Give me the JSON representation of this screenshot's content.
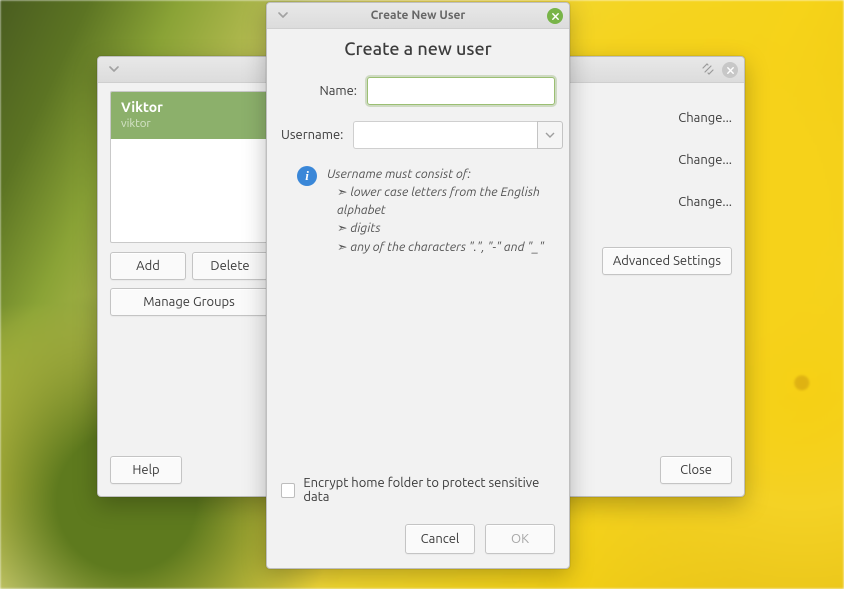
{
  "users_window": {
    "user": {
      "name": "Viktor",
      "role": "viktor"
    },
    "buttons": {
      "add": "Add",
      "delete": "Delete",
      "manage_groups": "Manage Groups"
    },
    "change_links": [
      "Change...",
      "Change...",
      "Change..."
    ],
    "advanced": "Advanced Settings",
    "help": "Help",
    "close": "Close"
  },
  "create_window": {
    "titlebar": "Create New User",
    "heading": "Create a new user",
    "labels": {
      "name": "Name:",
      "username": "Username:"
    },
    "fields": {
      "name_value": "",
      "username_value": ""
    },
    "info": {
      "header": "Username must consist of:",
      "bullets": [
        "lower case letters from the English alphabet",
        "digits",
        "any of the characters \".\", \"-\" and \"_\""
      ]
    },
    "encrypt": "Encrypt home folder to protect sensitive data",
    "cancel": "Cancel",
    "ok": "OK"
  }
}
